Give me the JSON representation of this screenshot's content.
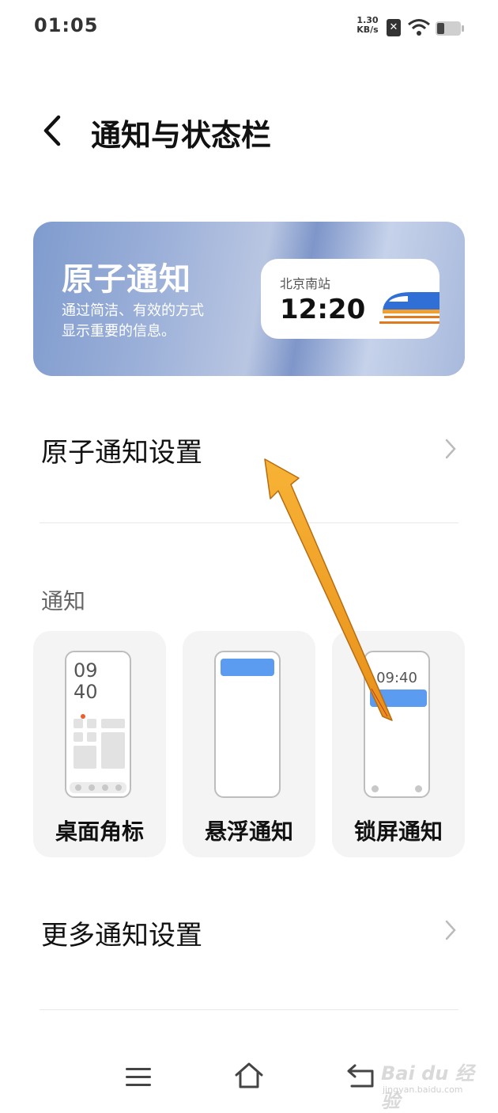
{
  "status_bar": {
    "time": "01:05",
    "net_speed_value": "1.30",
    "net_speed_unit": "KB/s",
    "sim_icon": "sim-off-icon",
    "wifi_icon": "wifi-icon",
    "battery_icon": "battery-low-icon"
  },
  "header": {
    "title": "通知与状态栏",
    "back_icon": "back-chevron-icon"
  },
  "banner": {
    "title": "原子通知",
    "desc_line1": "通过简洁、有效的方式",
    "desc_line2": "显示重要的信息。",
    "card_station": "北京南站",
    "card_time": "12:20",
    "card_icon": "train-icon"
  },
  "settings": {
    "atomic_label": "原子通知设置",
    "section_label": "通知",
    "more_label": "更多通知设置"
  },
  "notification_styles": [
    {
      "label": "桌面角标",
      "preview_time_line1": "09",
      "preview_time_line2": "40"
    },
    {
      "label": "悬浮通知"
    },
    {
      "label": "锁屏通知",
      "preview_time": "09:40"
    }
  ],
  "nav_bar": {
    "menu_icon": "menu-icon",
    "home_icon": "home-icon",
    "back_icon": "back-icon"
  },
  "watermark": {
    "text": "Bai du 经验",
    "url": "jingyan.baidu.com"
  },
  "colors": {
    "accent_blue": "#5b9bf0",
    "arrow_orange": "#f5a623",
    "badge_dot": "#e8602c"
  }
}
